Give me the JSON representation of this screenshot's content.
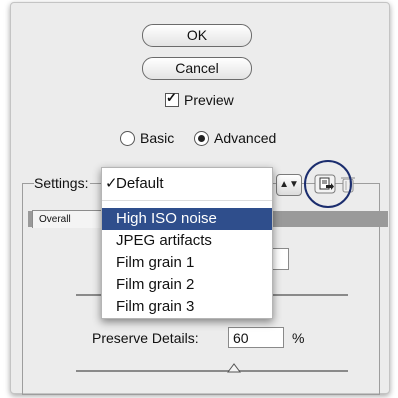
{
  "buttons": {
    "ok_label": "OK",
    "cancel_label": "Cancel"
  },
  "preview": {
    "label": "Preview",
    "checked": true
  },
  "mode": {
    "basic_label": "Basic",
    "advanced_label": "Advanced",
    "selected": "Advanced"
  },
  "settings": {
    "label": "Settings:",
    "selected": "Default"
  },
  "menu": {
    "items": [
      {
        "label": "Default",
        "checked": true
      },
      {
        "label": "High ISO noise",
        "highlighted": true
      },
      {
        "label": "JPEG artifacts"
      },
      {
        "label": "Film grain 1"
      },
      {
        "label": "Film grain 2"
      },
      {
        "label": "Film grain 3"
      }
    ],
    "checkmark": "✓"
  },
  "tabs": {
    "overall_label": "Overall"
  },
  "preserve_details": {
    "label": "Preserve Details:",
    "value": "60",
    "unit": "%"
  },
  "icons": {
    "save_preset": "save-settings-icon",
    "delete_preset": "trash-icon"
  },
  "colors": {
    "accent": "#2f4e8c",
    "ring": "#1b2d6e",
    "panel": "#ececec"
  }
}
